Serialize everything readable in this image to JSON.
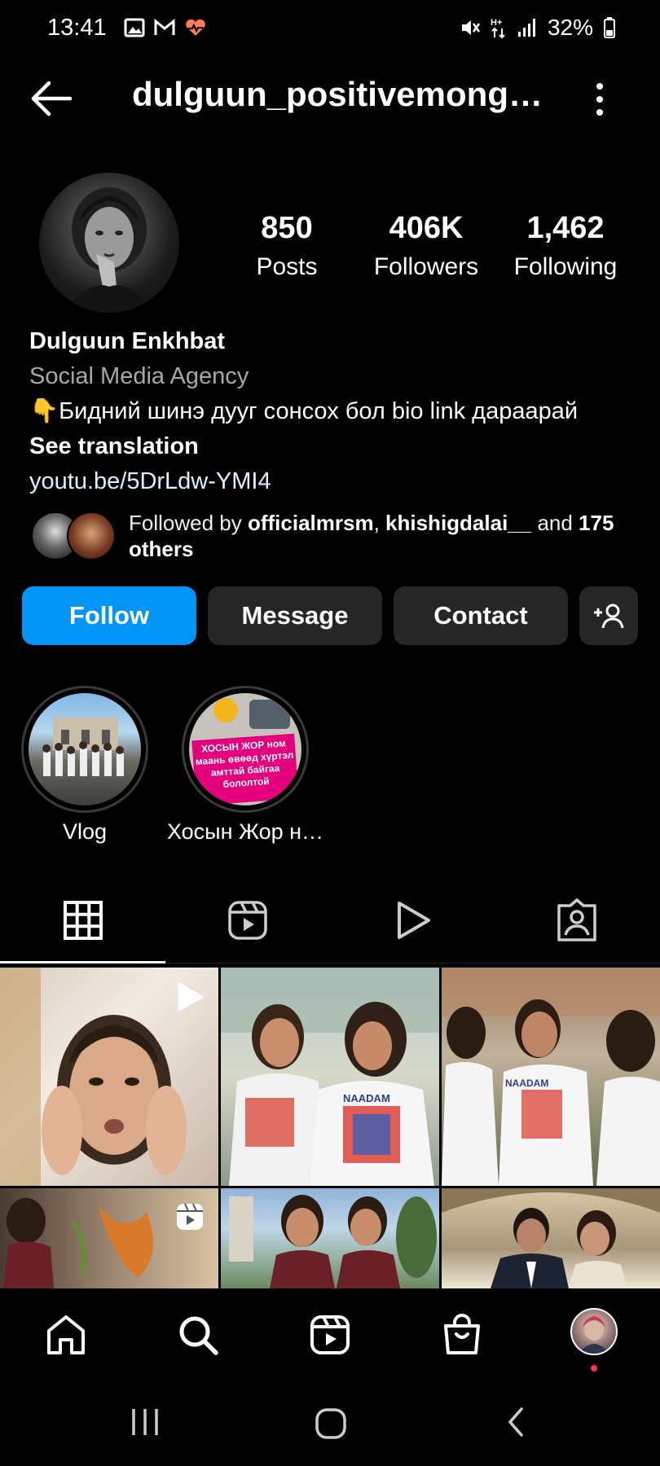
{
  "status_bar": {
    "time": "13:41",
    "battery": "32%"
  },
  "header": {
    "username": "dulguun_positivemongo…"
  },
  "profile": {
    "stats": [
      {
        "number": "850",
        "label": "Posts"
      },
      {
        "number": "406K",
        "label": "Followers"
      },
      {
        "number": "1,462",
        "label": "Following"
      }
    ],
    "name": "Dulguun Enkhbat",
    "category": "Social Media Agency",
    "bio": "👇Бидний шинэ дууг сонсох бол bio link дараарай",
    "see_translation": "See translation",
    "link": "youtu.be/5DrLdw-YMI4",
    "followed_by": {
      "prefix": "Followed by ",
      "user1": "officialmrsm",
      "sep": ", ",
      "user2": "khishigdalai__",
      "and": " and ",
      "others": "175 others"
    }
  },
  "buttons": {
    "follow": "Follow",
    "message": "Message",
    "contact": "Contact"
  },
  "highlights": [
    {
      "label": "Vlog"
    },
    {
      "label": "Хосын Жор н…",
      "cover_text": "ХОСЫН ЖОР ном маань өвөөд хүртэл амттай байгаа бололтой"
    }
  ],
  "grid_posts": [
    {
      "overlay": "play"
    },
    {
      "shirt_text": "NAADAM"
    },
    {
      "shirt_text": "NAADAM"
    },
    {
      "overlay": "reel"
    },
    {},
    {}
  ],
  "colors": {
    "accent": "#0095f6",
    "button_bg": "#262626",
    "notification": "#ff3040"
  }
}
